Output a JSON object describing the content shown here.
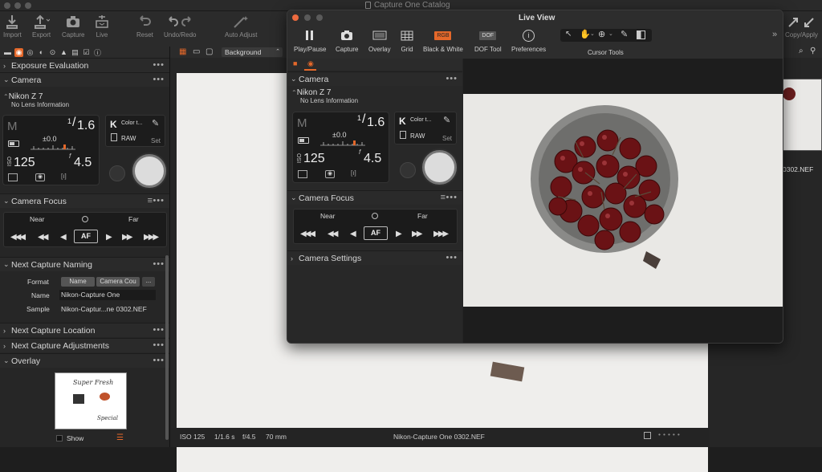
{
  "app": {
    "title": "Capture One Catalog"
  },
  "toolbar": {
    "import": "Import",
    "export": "Export",
    "capture": "Capture",
    "live": "Live",
    "reset": "Reset",
    "undo_redo": "Undo/Redo",
    "auto_adjust": "Auto Adjust",
    "copy_apply": "Copy/Apply"
  },
  "left_panel": {
    "sections": {
      "exposure": "Exposure Evaluation",
      "camera": "Camera",
      "camera_focus": "Camera Focus",
      "next_naming": "Next Capture Naming",
      "next_location": "Next Capture Location",
      "next_adjustments": "Next Capture Adjustments",
      "overlay": "Overlay"
    },
    "camera": {
      "model": "Nikon Z 7",
      "lens": "No Lens Information",
      "mode": "M",
      "shutter_num": "1",
      "shutter_den": "1.6",
      "ev": "±0.0",
      "iso_label": "ISO",
      "iso": "125",
      "aperture_f": "f",
      "aperture": "4.5",
      "wb_letter": "K",
      "wb_label": "Color t...",
      "format": "RAW",
      "set": "Set"
    },
    "focus": {
      "near": "Near",
      "far": "Far",
      "af": "AF"
    },
    "naming": {
      "format_label": "Format",
      "token1": "Name",
      "token2": "Camera Cou",
      "token_more": "...",
      "name_label": "Name",
      "name_value": "Nikon-Capture One",
      "sample_label": "Sample",
      "sample_value": "Nikon-Captur...ne 0302.NEF"
    },
    "overlay": {
      "show": "Show",
      "thumb_title": "Super Fresh",
      "thumb_sig": "Special"
    }
  },
  "viewer": {
    "background_select": "Background",
    "status": {
      "iso": "ISO 125",
      "shutter": "1/1.6 s",
      "aperture": "f/4.5",
      "focal": "70 mm",
      "filename": "Nikon-Capture One 0302.NEF"
    }
  },
  "right_panel": {
    "filename": "0302.NEF"
  },
  "live_view": {
    "title": "Live View",
    "tools": {
      "play_pause": "Play/Pause",
      "capture": "Capture",
      "overlay": "Overlay",
      "grid": "Grid",
      "bw": "Black & White",
      "bw_badge": "RGB",
      "dof": "DOF Tool",
      "dof_badge": "DOF",
      "preferences": "Preferences",
      "cursor_tools": "Cursor Tools"
    },
    "sections": {
      "camera": "Camera",
      "camera_focus": "Camera Focus",
      "camera_settings": "Camera Settings"
    },
    "camera": {
      "model": "Nikon Z 7",
      "lens": "No Lens Information",
      "mode": "M",
      "shutter_num": "1",
      "shutter_den": "1.6",
      "ev": "±0.0",
      "iso_label": "ISO",
      "iso": "125",
      "aperture_f": "f",
      "aperture": "4.5",
      "wb_letter": "K",
      "wb_label": "Color t...",
      "format": "RAW",
      "set": "Set"
    },
    "focus": {
      "near": "Near",
      "far": "Far",
      "af": "AF"
    }
  }
}
